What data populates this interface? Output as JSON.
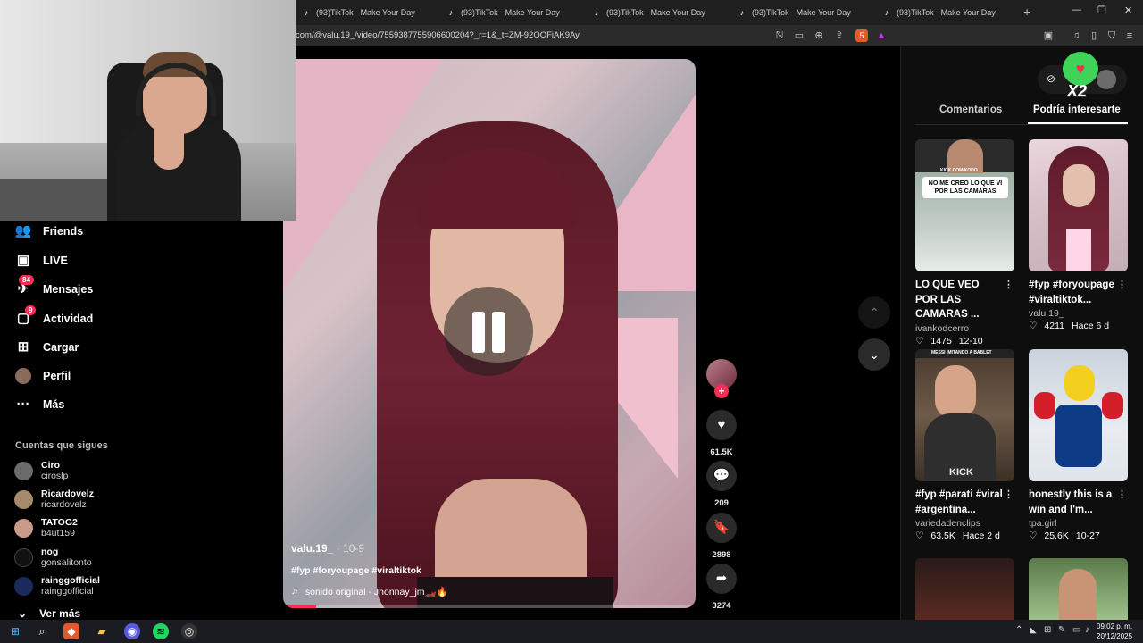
{
  "browser": {
    "tabs": [
      {
        "title": "(93)TikTok - Make Your Day"
      },
      {
        "title": "(93)TikTok - Make Your Day"
      },
      {
        "title": "(93)TikTok - Make Your Day"
      },
      {
        "title": "(93)TikTok - Make Your Day"
      },
      {
        "title": "(93)TikTok - Make Your Day"
      }
    ],
    "new_tab": "+",
    "url": "com/@valu.19_/video/7559387755906600204?_r=1&_t=ZM-92OOFiAK9Ay",
    "shield_count": "5"
  },
  "sidebar": {
    "nav": [
      {
        "label": "Friends",
        "icon": "friends-icon"
      },
      {
        "label": "LIVE",
        "icon": "live-icon"
      },
      {
        "label": "Mensajes",
        "icon": "messages-icon",
        "badge": "84"
      },
      {
        "label": "Actividad",
        "icon": "activity-icon",
        "badge": "9"
      },
      {
        "label": "Cargar",
        "icon": "upload-icon"
      },
      {
        "label": "Perfil",
        "icon": "profile-icon"
      },
      {
        "label": "Más",
        "icon": "more-icon"
      }
    ],
    "following_title": "Cuentas que sigues",
    "following": [
      {
        "name": "Ciro",
        "handle": "ciroslp"
      },
      {
        "name": "Ricardovelz",
        "handle": "ricardovelz"
      },
      {
        "name": "TATOG2",
        "handle": "b4ut159"
      },
      {
        "name": "nog",
        "handle": "gonsalitonto"
      },
      {
        "name": "rainggofficial",
        "handle": "rainggofficial"
      }
    ],
    "see_more": "Ver más"
  },
  "video": {
    "username": "valu.19_",
    "date": " · 10-9",
    "hashtags": "#fyp #foryoupage #viraltiktok",
    "sound": "sonido original - Jhonnay_jm🏎️🔥",
    "progress": 0.08
  },
  "actions": {
    "likes": "61.5K",
    "comments": "209",
    "saves": "2898",
    "shares": "3274"
  },
  "right_panel": {
    "tabs": [
      "Comentarios",
      "Podría interesarte"
    ],
    "active_tab": "Podría interesarte",
    "cards": [
      {
        "title": "LO QUE VEO POR LAS CAMARAS ...",
        "author": "ivankodcerro",
        "likes": "1475",
        "date": "12-10",
        "overlay": "NO ME CREO LO QUE VI POR LAS CAMARAS",
        "overlay_top": "KICK.COM/KODO"
      },
      {
        "title": "#fyp #foryoupage #viraltiktok...",
        "author": "valu.19_",
        "likes": "4211",
        "date": "Hace 6 d"
      },
      {
        "title": "#fyp #parati #viral #argentina...",
        "author": "variedadenclips",
        "likes": "63.5K",
        "date": "Hace 2 d",
        "overlay_top": "MESSI IMITANDO A BABLET",
        "overlay_bottom": "KICK"
      },
      {
        "title": "honestly this is a win and I'm...",
        "author": "tpa.girl",
        "likes": "25.6K",
        "date": "10-27"
      }
    ]
  },
  "sticker": {
    "label": "X2"
  },
  "taskbar": {
    "time": "09:02 p. m.",
    "date": "20/12/2025"
  },
  "colors": {
    "accent": "#fe2c55",
    "background": "#000000",
    "panel": "#0e0e0e"
  }
}
